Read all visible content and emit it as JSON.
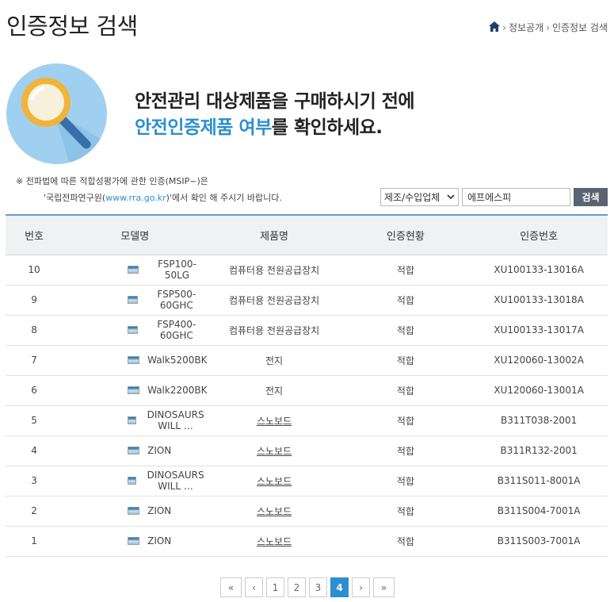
{
  "header": {
    "title": "인증정보 검색",
    "breadcrumb": [
      "정보공개",
      "인증정보 검색"
    ]
  },
  "hero": {
    "line1": "안전관리 대상제품을 구매하시기 전에",
    "line2_accent": "안전인증제품 여부",
    "line2_rest": "를 확인하세요."
  },
  "notice": {
    "line1": "※ 전파법에 따른 적합성평가에 관한 인증(MSIP~)은",
    "line2_pre": "'국립전파연구원(",
    "line2_link": "www.rra.go.kr",
    "line2_post": ")'에서 확인 해 주시기 바랍니다."
  },
  "search": {
    "select_value": "제조/수입업체",
    "input_value": "에프에스피",
    "button_label": "검색"
  },
  "table": {
    "headers": [
      "번호",
      "모델명",
      "제품명",
      "인증현황",
      "인증번호"
    ],
    "rows": [
      {
        "no": "10",
        "model": "FSP100-50LG",
        "product": "컴퓨터용 전원공급장치",
        "status": "적합",
        "cert": "XU100133-13016A"
      },
      {
        "no": "9",
        "model": "FSP500-60GHC",
        "product": "컴퓨터용 전원공급장치",
        "status": "적합",
        "cert": "XU100133-13018A"
      },
      {
        "no": "8",
        "model": "FSP400-60GHC",
        "product": "컴퓨터용 전원공급장치",
        "status": "적합",
        "cert": "XU100133-13017A"
      },
      {
        "no": "7",
        "model": "Walk5200BK",
        "product": "전지",
        "status": "적합",
        "cert": "XU120060-13002A"
      },
      {
        "no": "6",
        "model": "Walk2200BK",
        "product": "전지",
        "status": "적합",
        "cert": "XU120060-13001A"
      },
      {
        "no": "5",
        "model": "DINOSAURS WILL …",
        "product": "스노보드",
        "status": "적합",
        "cert": "B311T038-2001"
      },
      {
        "no": "4",
        "model": "ZION",
        "product": "스노보드",
        "status": "적합",
        "cert": "B311R132-2001"
      },
      {
        "no": "3",
        "model": "DINOSAURS WILL …",
        "product": "스노보드",
        "status": "적합",
        "cert": "B311S011-8001A"
      },
      {
        "no": "2",
        "model": "ZION",
        "product": "스노보드",
        "status": "적합",
        "cert": "B311S004-7001A"
      },
      {
        "no": "1",
        "model": "ZION",
        "product": "스노보드",
        "status": "적합",
        "cert": "B311S003-7001A"
      }
    ]
  },
  "pagination": {
    "first": "«",
    "prev": "‹",
    "pages": [
      "1",
      "2",
      "3",
      "4"
    ],
    "current": "4",
    "next": "›",
    "last": "»"
  },
  "icons": {
    "home": "home-icon",
    "hero": "magnifier-icon",
    "row_thumb": "image-thumbnail-icon",
    "select_arrow": "chevron-down-icon"
  },
  "colors": {
    "accent": "#2b8fd1",
    "hero_circle": "#9fd0ef",
    "search_button": "#5a6470",
    "header_border": "#6b9dc6"
  }
}
